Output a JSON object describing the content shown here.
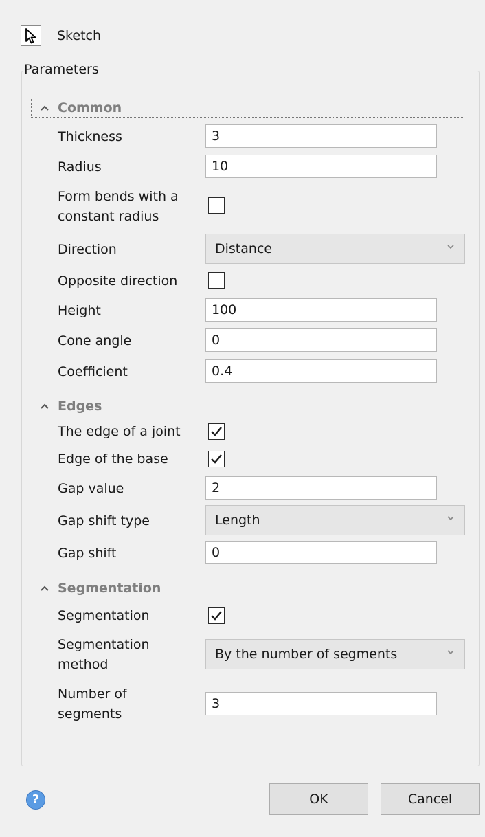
{
  "header": {
    "sketch_label": "Sketch",
    "sketch_icon": "cursor-arrow-icon"
  },
  "parameters": {
    "title": "Parameters"
  },
  "common": {
    "title": "Common",
    "thickness_label": "Thickness",
    "thickness_value": "3",
    "radius_label": "Radius",
    "radius_value": "10",
    "form_bends_label_line1": "Form bends with a",
    "form_bends_label_line2": "constant radius",
    "form_bends_checked": false,
    "direction_label": "Direction",
    "direction_value": "Distance",
    "opposite_label": "Opposite direction",
    "opposite_checked": false,
    "height_label": "Height",
    "height_value": "100",
    "cone_label": "Cone angle",
    "cone_value": "0",
    "coefficient_label": "Coefficient",
    "coefficient_value": "0.4"
  },
  "edges": {
    "title": "Edges",
    "joint_label": "The edge of a joint",
    "joint_checked": true,
    "base_label": "Edge of the base",
    "base_checked": true,
    "gap_value_label": "Gap value",
    "gap_value": "2",
    "gap_shift_type_label": "Gap shift type",
    "gap_shift_type_value": "Length",
    "gap_shift_label": "Gap shift",
    "gap_shift_value": "0"
  },
  "segmentation": {
    "title": "Segmentation",
    "seg_label": "Segmentation",
    "seg_checked": true,
    "method_label_line1": "Segmentation",
    "method_label_line2": "method",
    "method_value": "By the number of segments",
    "count_label_line1": "Number of",
    "count_label_line2": "segments",
    "count_value": "3"
  },
  "footer": {
    "help_glyph": "?",
    "ok_label": "OK",
    "cancel_label": "Cancel"
  }
}
